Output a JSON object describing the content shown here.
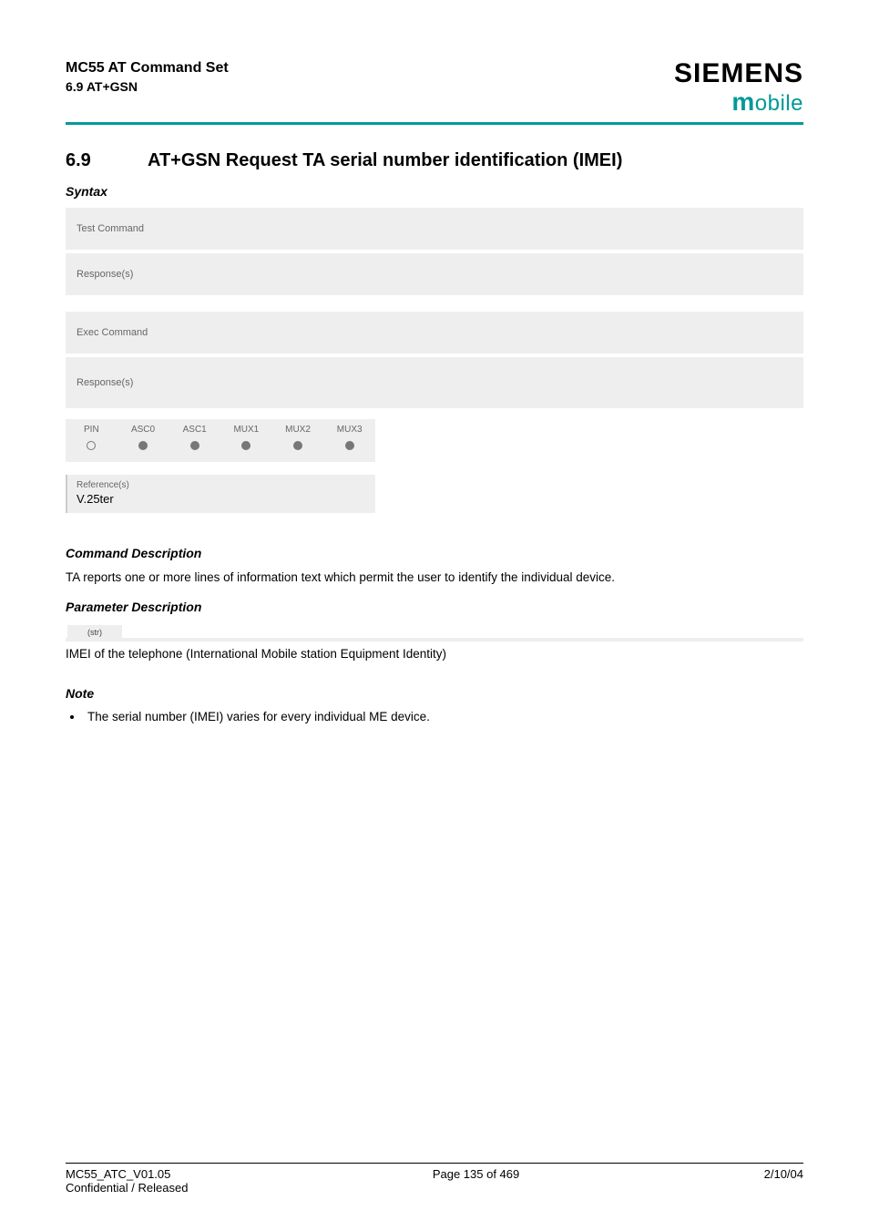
{
  "header": {
    "doc_title": "MC55 AT Command Set",
    "doc_sub": "6.9 AT+GSN",
    "brand_top": "SIEMENS",
    "brand_bottom_m": "m",
    "brand_bottom_rest": "obile"
  },
  "section": {
    "number": "6.9",
    "title": "AT+GSN   Request TA serial number identification (IMEI)"
  },
  "syntax": {
    "heading": "Syntax",
    "test_command_label": "Test Command",
    "test_response_label": "Response(s)",
    "exec_command_label": "Exec Command",
    "exec_response_label": "Response(s)"
  },
  "flags": {
    "headers": [
      "PIN",
      "ASC0",
      "ASC1",
      "MUX1",
      "MUX2",
      "MUX3"
    ],
    "values": [
      "open",
      "fill",
      "fill",
      "fill",
      "fill",
      "fill"
    ]
  },
  "reference": {
    "label": "Reference(s)",
    "value": "V.25ter"
  },
  "command_desc": {
    "heading": "Command Description",
    "text": "TA reports one or more lines of information text which permit the user to identify the individual device."
  },
  "param_desc": {
    "heading": "Parameter Description",
    "tag": "(str)",
    "text": "IMEI of the telephone (International Mobile station Equipment Identity)"
  },
  "note": {
    "heading": "Note",
    "items": [
      "The serial number (IMEI) varies for every individual ME device."
    ]
  },
  "footer": {
    "left_line1": "MC55_ATC_V01.05",
    "left_line2": "Confidential / Released",
    "center": "Page 135 of 469",
    "right": "2/10/04"
  }
}
